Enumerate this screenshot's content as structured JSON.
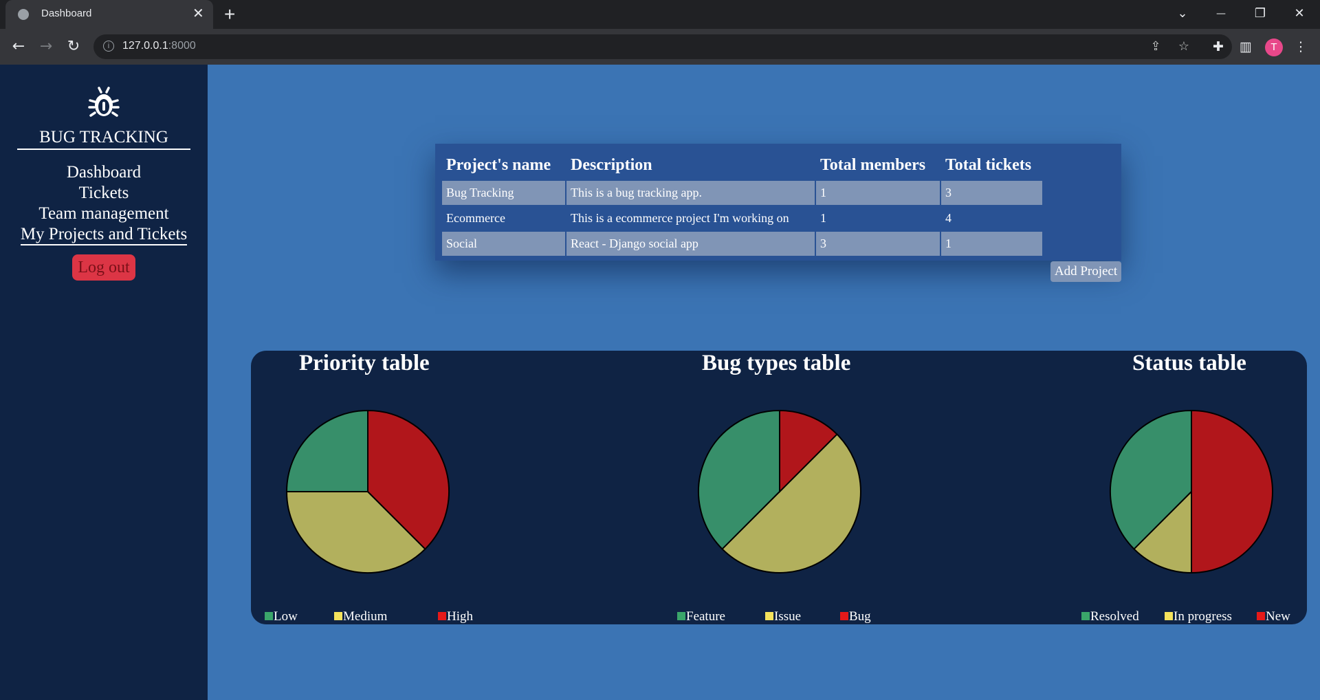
{
  "browser": {
    "tab_title": "Dashboard",
    "tab_close": "✕",
    "new_tab": "+",
    "url_host": "127.0.0.1",
    "url_port": ":8000",
    "profile_initial": "T",
    "window_buttons": {
      "tab_search": "⌄",
      "minimize": "—",
      "restore": "❐",
      "close": "✕"
    }
  },
  "sidebar": {
    "brand": "BUG TRACKING",
    "links": [
      "Dashboard",
      "Tickets",
      "Team management",
      "My Projects and Tickets"
    ],
    "logout": "Log out"
  },
  "projects": {
    "headers": [
      "Project's name",
      "Description",
      "Total members",
      "Total tickets"
    ],
    "rows": [
      [
        "Bug Tracking",
        "This is a bug tracking app.",
        "1",
        "3"
      ],
      [
        "Ecommerce",
        "This is a ecommerce project I'm working on",
        "1",
        "4"
      ],
      [
        "Social",
        "React - Django social app",
        "3",
        "1"
      ]
    ],
    "add_button": "Add Project"
  },
  "colors": {
    "green": "#378f6a",
    "yellow": "#b2b05d",
    "red": "#b1161b",
    "legend_green": "#3aa56a",
    "legend_yellow": "#f4e25c",
    "legend_red": "#e51919"
  },
  "chart_data": [
    {
      "type": "pie",
      "title": "Priority table",
      "categories": [
        "Low",
        "Medium",
        "High"
      ],
      "values": [
        2,
        3,
        3
      ]
    },
    {
      "type": "pie",
      "title": "Bug types table",
      "categories": [
        "Feature",
        "Issue",
        "Bug"
      ],
      "values": [
        3,
        4,
        1
      ]
    },
    {
      "type": "pie",
      "title": "Status table",
      "categories": [
        "Resolved",
        "In progress",
        "New"
      ],
      "values": [
        3,
        1,
        4
      ]
    }
  ]
}
